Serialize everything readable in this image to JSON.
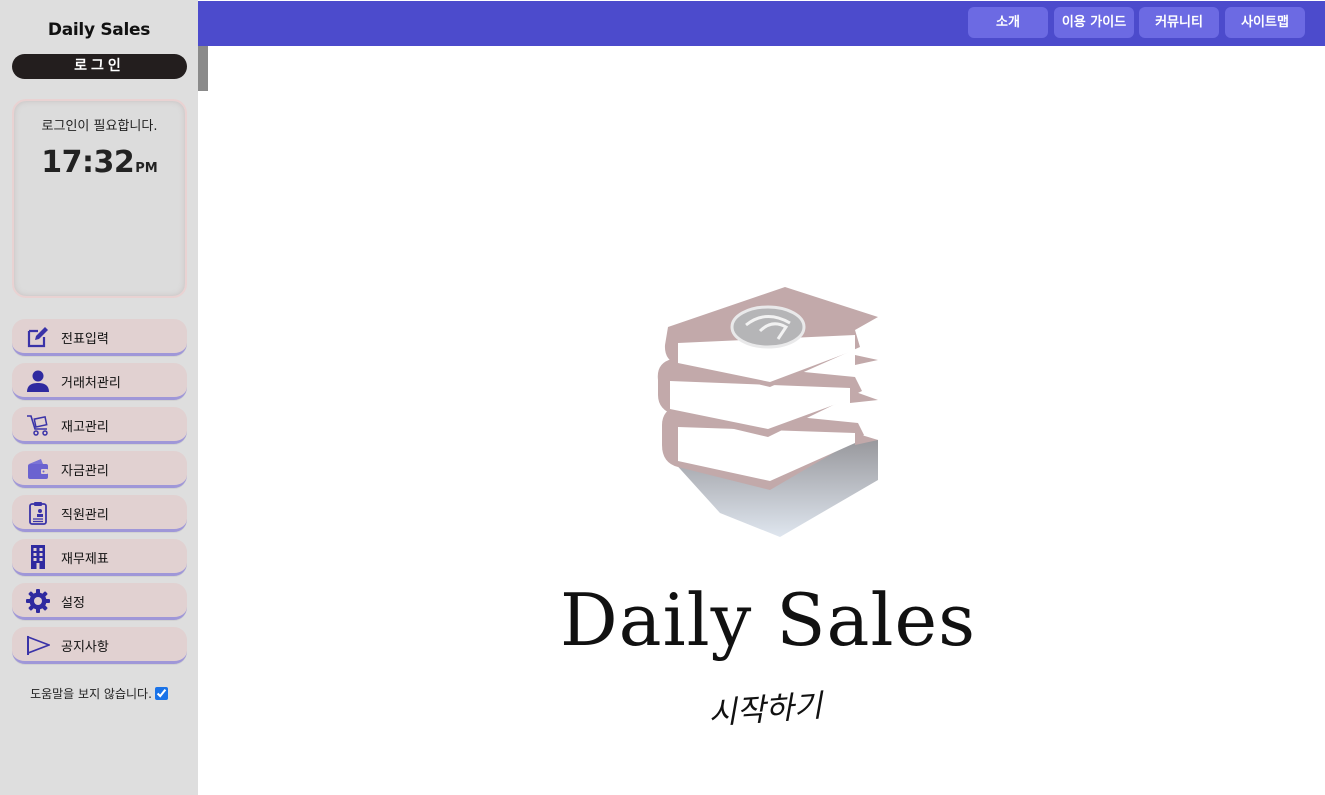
{
  "sidebar": {
    "app_title": "Daily Sales",
    "login_label": "로그인",
    "info": {
      "message": "로그인이 필요합니다.",
      "time": "17:32",
      "ampm": "PM"
    },
    "menu": [
      {
        "label": "전표입력",
        "icon": "pencil-square-icon"
      },
      {
        "label": "거래처관리",
        "icon": "person-icon"
      },
      {
        "label": "재고관리",
        "icon": "cart-icon"
      },
      {
        "label": "자금관리",
        "icon": "wallet-icon"
      },
      {
        "label": "직원관리",
        "icon": "clipboard-icon"
      },
      {
        "label": "재무제표",
        "icon": "building-icon"
      },
      {
        "label": "설정",
        "icon": "gear-icon"
      },
      {
        "label": "공지사항",
        "icon": "flag-icon"
      }
    ],
    "help_label": "도움말을 보지 않습니다.",
    "help_checked": true
  },
  "topnav": [
    {
      "label": "소개"
    },
    {
      "label": "이용 가이드"
    },
    {
      "label": "커뮤니티"
    },
    {
      "label": "사이트맵"
    }
  ],
  "main": {
    "brand": "Daily Sales",
    "start_label": "시작하기"
  },
  "colors": {
    "topbar": "#4c4bcc",
    "nav_button": "#6c6ae3",
    "menu_bg": "#e1d1d1",
    "menu_underline": "#9f97d8",
    "icon": "#3a33a8",
    "book": "#c2a9aa"
  }
}
